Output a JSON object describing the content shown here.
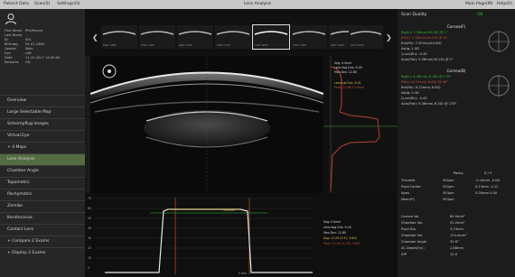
{
  "menubar": {
    "items": [
      "Patient Data",
      "Scan(S)",
      "Settings(O)"
    ],
    "title": "Lens Analysis",
    "right_items": [
      "Main Page(M)",
      "Help(H)"
    ]
  },
  "patient": {
    "fields": [
      {
        "label": "First Name",
        "value": "Phil/Hanna"
      },
      {
        "label": "Last Name",
        "value": ""
      },
      {
        "label": "ID",
        "value": "001"
      },
      {
        "label": "Birthday",
        "value": "05-01-1986"
      },
      {
        "label": "Gender",
        "value": "Male"
      },
      {
        "label": "Eye",
        "value": "Left"
      },
      {
        "label": "Date",
        "value": "11-15-2017 14:05:00"
      },
      {
        "label": "Remarks",
        "value": "OD"
      }
    ]
  },
  "nav": {
    "items": [
      {
        "label": "Overview",
        "active": false
      },
      {
        "label": "Large Selectable Map",
        "active": false
      },
      {
        "label": "Scheimpflug Images",
        "active": false
      },
      {
        "label": "Virtual Eye",
        "active": false
      },
      {
        "label": "+ 4 Maps",
        "active": false
      },
      {
        "label": "Lens Analysis",
        "active": true
      },
      {
        "label": "Chamber Angle",
        "active": false
      },
      {
        "label": "Topometric",
        "active": false
      },
      {
        "label": "Pachymetric",
        "active": false
      },
      {
        "label": "Zernike",
        "active": false
      },
      {
        "label": "Keratoconus",
        "active": false
      },
      {
        "label": "Contact Lens",
        "active": false
      },
      {
        "label": "+ Compare 2 Exams",
        "active": false
      },
      {
        "label": "+ Display 2 Exams",
        "active": false
      }
    ]
  },
  "thumbs": {
    "labels": [
      "000°-180°",
      "030°-210°",
      "060°-240°",
      "090°-270°",
      "120°-300°",
      "150°-330°",
      "180°-000°",
      "210°-030°"
    ],
    "selected_index": 4
  },
  "profile": {
    "labels": [
      "Seg: 0.0mm",
      "Lens Avg Dns: 9.16",
      "Max Dns: 12.80",
      "Lens Lgt Dns: 6.01",
      "Peak: 12.80  12.0mm"
    ]
  },
  "bottom_chart": {
    "y_ticks": [
      "70",
      "60",
      "50",
      "40",
      "30",
      "20",
      "10",
      "0"
    ],
    "x_label": "0 mm",
    "peak_label": "3.20mm",
    "info": [
      "Seg: 0.0mm",
      "Lens Avg Dns: 9.16",
      "Max Dns: 12.80",
      "Avg: 11.26 (5.57, 9.80)",
      "Peak: 12.80 (11.00, 9.60)"
    ]
  },
  "right": {
    "scan_quality_label": "Scan Quality",
    "scan_quality_value": "OK",
    "cornea_front_title": "Cornea(F)",
    "cornea_front_rows": [
      "Rgl(h): 7.76mm(43.5D) @ 1°",
      "Rfl(v): 7.58mm(44.5D) @ 91°",
      "Rm(Rh): 7.67mm(44.0D)",
      "Astig: 1.0D",
      "Q-val(Rh): -0.32",
      "Axis(Flat): 5.58mm(43.2D) @ 1°"
    ],
    "cornea_back_title": "Cornea(B)",
    "cornea_back_rows": [
      "Rgl(h): 6.38mm(-6.3D) @ 178°",
      "Rfl(v): 6.07mm(-6.6D) @ 88°",
      "Rm(Rh): 6.22mm(-6.5D)",
      "Astig: 0.3D",
      "Q-val(Rh): -0.45",
      "Axis(Flat): 6.38mm(-6.3D) @ 178°"
    ],
    "pachy_header": [
      "Pachy",
      "X / Y"
    ],
    "pachy_rows": [
      {
        "label": "Thinnest",
        "v": "545µm",
        "xy": "-0.14mm  -0.08"
      },
      {
        "label": "Pupil Center",
        "v": "550µm",
        "xy": "0.13mm  -0.12"
      },
      {
        "label": "Apex",
        "v": "553µm",
        "xy": "0.00mm  0.00"
      },
      {
        "label": "Mean(P)",
        "v": "553µm",
        "xy": ""
      }
    ],
    "bottom_rows": [
      {
        "label": "Cornea Vol.",
        "value": "60.0mm³"
      },
      {
        "label": "Chamber Vol.",
        "value": "51.2mm³"
      },
      {
        "label": "Pupil Dia",
        "value": "3.23mm"
      },
      {
        "label": "Chamber Vol.",
        "value": "174.4mm³"
      },
      {
        "label": "Chamber Angle",
        "value": "35.8°"
      },
      {
        "label": "AC Depth(Int.)",
        "value": "2.86mm"
      },
      {
        "label": "IOP",
        "value": "15.0"
      }
    ]
  }
}
